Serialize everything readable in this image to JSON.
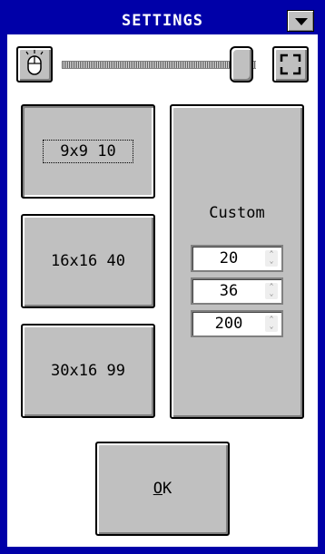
{
  "window": {
    "title": "SETTINGS",
    "menu_icon": "chevron-down-icon"
  },
  "toolbar": {
    "mouse_icon": "mouse-icon",
    "fullscreen_icon": "fullscreen-icon",
    "slider_value_percent": 100
  },
  "presets": [
    {
      "label": "9x9 10",
      "selected": true
    },
    {
      "label": "16x16 40",
      "selected": false
    },
    {
      "label": "30x16 99",
      "selected": false
    }
  ],
  "custom": {
    "label": "Custom",
    "width": "20",
    "height": "36",
    "mines": "200"
  },
  "ok": {
    "accel": "O",
    "rest": "K"
  },
  "colors": {
    "background": "#0000a8",
    "face": "#c0c0c0",
    "title_text": "#ffffff"
  }
}
